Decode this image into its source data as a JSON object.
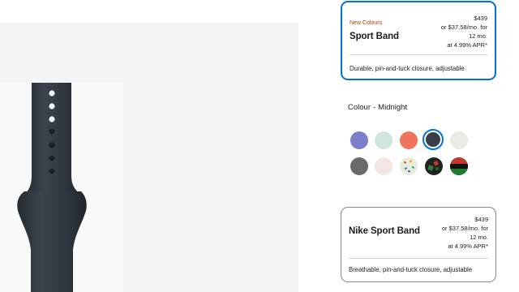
{
  "product": {
    "image_alt": "Midnight Sport Band"
  },
  "sport_band": {
    "tag": "New Colours",
    "name": "Sport Band",
    "price_line1": "$439",
    "price_line2": "or $37.58/mo. for",
    "price_line3": "12 mo.",
    "price_line4": "at 4.99% APR*",
    "description": "Durable, pin-and-tuck closure, adjustable",
    "selected": true
  },
  "colour": {
    "label": "Colour",
    "separator": "-",
    "selected_name": "Midnight",
    "swatches": [
      {
        "name": "Purple",
        "color": "#7b7ec9"
      },
      {
        "name": "Light Mint",
        "color": "#cfe6dc"
      },
      {
        "name": "Coral",
        "color": "#f0735d"
      },
      {
        "name": "Midnight",
        "color": "#3a3f47",
        "selected": true
      },
      {
        "name": "Starlight",
        "color": "#eceae4"
      },
      {
        "name": "Graphite",
        "color": "#6a6a6c"
      },
      {
        "name": "Light Pink",
        "color": "#f4e6e4"
      },
      {
        "name": "Pride Edition",
        "color": "#e8ecdc"
      },
      {
        "name": "Black Unity",
        "color": "#1e2320"
      },
      {
        "name": "Black Unity Stripes",
        "color": "#2a2a2a"
      }
    ]
  },
  "nike_band": {
    "name": "Nike Sport Band",
    "price_line1": "$439",
    "price_line2": "or $37.58/mo. for",
    "price_line3": "12 mo.",
    "price_line4": "at 4.99% APR*",
    "description": "Breathable, pin-and-tuck closure, adjustable",
    "selected": false
  },
  "colors": {
    "accent": "#0071e3",
    "tag": "#b64400",
    "panel_bg": "#f5f5f7",
    "band": "#2e353d"
  }
}
